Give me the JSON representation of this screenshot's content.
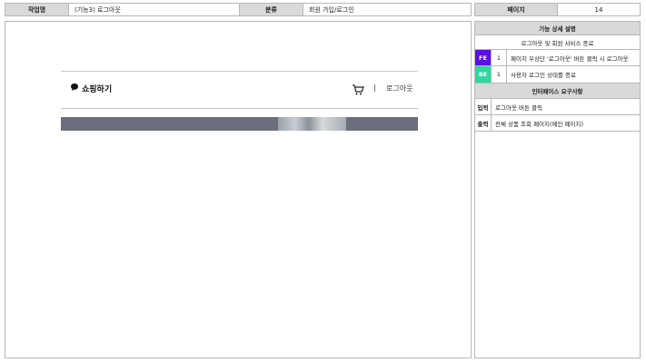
{
  "header": {
    "task_label": "작업명",
    "task_value": "(기능3) 로그아웃",
    "category_label": "분류",
    "category_value": "회원 가입/로그인",
    "page_label": "페이지",
    "page_value": "14"
  },
  "preview": {
    "brand": "쇼핑하기",
    "brand_icon": "chat-bubble-icon",
    "cart_icon": "cart-icon",
    "separator": "|",
    "logout": "로그아웃"
  },
  "spec": {
    "detail_title": "기능 상세 설명",
    "detail_summary": "로그아웃 및 회원 서비스 종료",
    "rows": [
      {
        "tag": "FE",
        "tag_color": "#5b0fe0",
        "num": "1",
        "desc": "페이지 우상단 '로그아웃' 버튼 클릭 시 로그아웃"
      },
      {
        "tag": "BE",
        "tag_color": "#2fd6a0",
        "num": "1",
        "desc": "사용자 로그인 상태를 종료"
      }
    ],
    "interface_title": "인터페이스 요구사항",
    "input_label": "입력",
    "input_value": "로그아웃 버튼 클릭",
    "output_label": "출력",
    "output_value": "전체 상품 조회 페이지(메인 페이지)"
  }
}
